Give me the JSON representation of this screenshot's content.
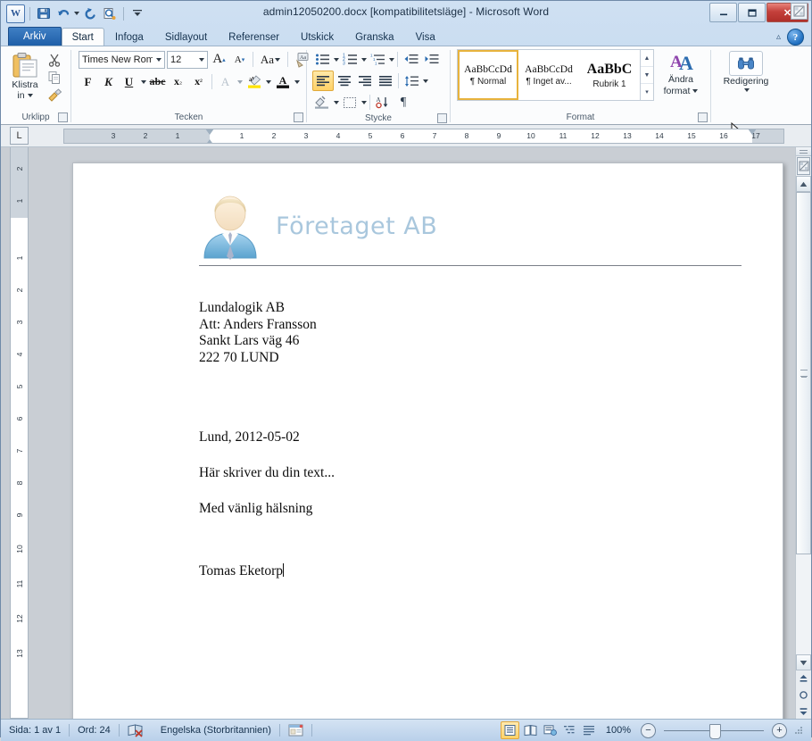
{
  "window": {
    "title": "admin12050200.docx [kompatibilitetsläge]  -  Microsoft Word",
    "minimize_label": "—",
    "restore_label": "❐",
    "close_label": "✕"
  },
  "quick_access": {
    "app_logo": "W",
    "items": [
      {
        "name": "save-icon",
        "tooltip": "Spara"
      },
      {
        "name": "undo-icon",
        "tooltip": "Ångra"
      },
      {
        "name": "redo-icon",
        "tooltip": "Gör om"
      },
      {
        "name": "print-preview-icon",
        "tooltip": "Förhandsgranska"
      },
      {
        "name": "customize-qat-icon",
        "tooltip": "Anpassa verktygsfältet Snabbåtkomst"
      }
    ]
  },
  "tabs": [
    {
      "id": "arkiv",
      "label": "Arkiv",
      "active": false,
      "file": true
    },
    {
      "id": "start",
      "label": "Start",
      "active": true
    },
    {
      "id": "infoga",
      "label": "Infoga",
      "active": false
    },
    {
      "id": "sidlayout",
      "label": "Sidlayout",
      "active": false
    },
    {
      "id": "referenser",
      "label": "Referenser",
      "active": false
    },
    {
      "id": "utskick",
      "label": "Utskick",
      "active": false
    },
    {
      "id": "granska",
      "label": "Granska",
      "active": false
    },
    {
      "id": "visa",
      "label": "Visa",
      "active": false
    }
  ],
  "ribbon": {
    "help_label": "?",
    "minimize_ribbon": "minimize-ribbon-icon",
    "groups": {
      "clipboard": {
        "label": "Urklipp",
        "paste_label_line1": "Klistra",
        "paste_label_line2": "in",
        "cut": "cut-icon",
        "copy": "copy-icon",
        "format_painter": "format-painter-icon"
      },
      "font": {
        "label": "Tecken",
        "font_name": "Times New Rom",
        "font_size": "12",
        "grow_font": "A",
        "shrink_font": "A",
        "change_case": "Aa",
        "clear_formatting": "clear-formatting-icon",
        "bold": "F",
        "italic": "K",
        "underline": "U",
        "strikethrough": "abc",
        "subscript": "x₂",
        "superscript": "x²",
        "text_effects": "A",
        "highlight": "ab",
        "font_color": "A"
      },
      "paragraph": {
        "label": "Stycke",
        "bullets": "bullet-list-icon",
        "numbering": "numbered-list-icon",
        "multilevel": "multilevel-list-icon",
        "decrease_indent": "decrease-indent-icon",
        "increase_indent": "increase-indent-icon",
        "align_left": "align-left-icon",
        "align_center": "align-center-icon",
        "align_right": "align-right-icon",
        "justify": "justify-icon",
        "line_spacing": "line-spacing-icon",
        "shading": "shading-icon",
        "borders": "borders-icon",
        "sort": "sort-icon",
        "show_marks": "¶"
      },
      "styles": {
        "label": "Format",
        "gallery": [
          {
            "preview": "AaBbCcDd",
            "name": "¶ Normal",
            "selected": true
          },
          {
            "preview": "AaBbCcDd",
            "name": "¶ Inget av...",
            "selected": false
          },
          {
            "preview": "AaBbC",
            "name": "Rubrik 1",
            "selected": false,
            "heading": true
          }
        ],
        "change_styles_line1": "Ändra",
        "change_styles_line2": "format"
      },
      "editing": {
        "label": "Redigering",
        "button_label": "Redigering",
        "icon": "binoculars-icon"
      }
    }
  },
  "ruler": {
    "tab_selector": "L",
    "horizontal_numbers_left": [
      "3",
      "2",
      "1"
    ],
    "horizontal_numbers_right": [
      "1",
      "2",
      "3",
      "4",
      "5",
      "6",
      "7",
      "8",
      "9",
      "10",
      "11",
      "12",
      "13",
      "14",
      "15",
      "16",
      "17"
    ],
    "vertical_header_numbers": [
      "2",
      "1"
    ],
    "vertical_numbers": [
      "1",
      "2",
      "3",
      "4",
      "5",
      "6",
      "7",
      "8",
      "9",
      "10",
      "11",
      "12",
      "13"
    ],
    "toggle_ruler": "toggle-ruler-icon"
  },
  "document": {
    "logo": "businessman-avatar-icon",
    "company_name": "Företaget AB",
    "recipient": [
      "Lundalogik AB",
      "Att: Anders Fransson",
      "Sankt Lars väg 46",
      "222 70 LUND"
    ],
    "place_date": "Lund, 2012-05-02",
    "body": "Här skriver du din text...",
    "closing": "Med vänlig hälsning",
    "signature": "Tomas Eketorp"
  },
  "scrollbar": {
    "split_bar": "split-bar-icon",
    "select_browse_object": "select-browse-object-icon",
    "scroll_up": "▲",
    "scroll_down": "▼",
    "previous_page": "previous-page-icon",
    "next_page": "next-page-icon"
  },
  "status_bar": {
    "page_info": "Sida: 1 av 1",
    "word_count": "Ord: 24",
    "proofing_icon": "proofing-errors-icon",
    "language": "Engelska (Storbritannien)",
    "macro_icon": "record-macro-icon",
    "views": [
      {
        "name": "print-layout-view",
        "selected": true
      },
      {
        "name": "full-screen-reading-view",
        "selected": false
      },
      {
        "name": "web-layout-view",
        "selected": false
      },
      {
        "name": "outline-view",
        "selected": false
      },
      {
        "name": "draft-view",
        "selected": false
      }
    ],
    "zoom_level": "100%",
    "zoom_out": "−",
    "zoom_in": "+"
  },
  "colors": {
    "accent_blue": "#1f5fa8",
    "company_text": "#a9c7dd",
    "selection_gold": "#e8b33c",
    "close_red": "#c4403b",
    "page_bg": "#c9ced4"
  }
}
